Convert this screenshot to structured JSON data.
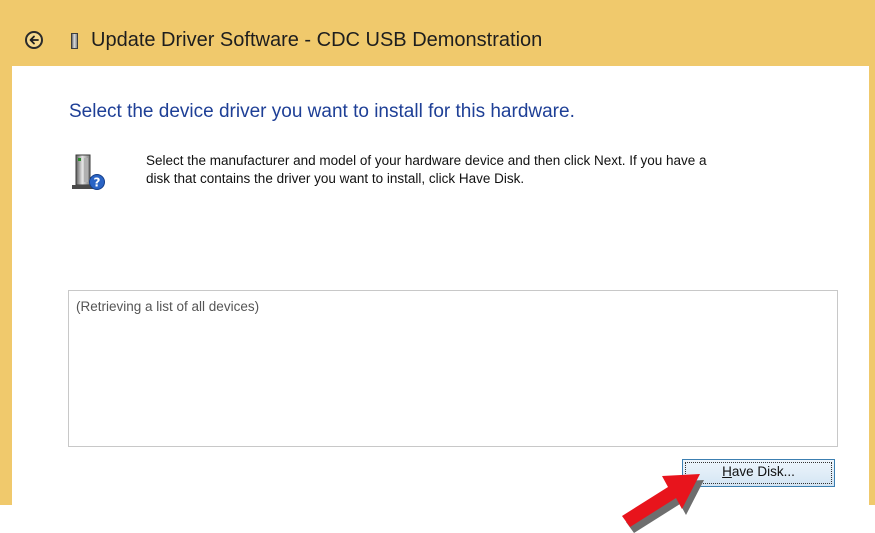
{
  "window": {
    "title": "Update Driver Software - CDC USB Demonstration",
    "frame_color": "#f0c96c"
  },
  "page": {
    "heading": "Select the device driver you want to install for this hardware.",
    "heading_color": "#1e3f96",
    "instruction_line1": "Select the manufacturer and model of your hardware device and then click Next. If you have a",
    "instruction_line2": "disk that contains the driver you want to install, click Have Disk."
  },
  "device_list": {
    "status": "(Retrieving a list of all devices)"
  },
  "buttons": {
    "have_disk": {
      "accelerator": "H",
      "rest": "ave Disk..."
    }
  },
  "icons": {
    "back": "back-arrow-icon",
    "title_device": "device-icon",
    "hardware": "hardware-help-icon",
    "annotation": "red-pointer-arrow"
  },
  "annotation": {
    "arrow_color": "#e8141c"
  }
}
